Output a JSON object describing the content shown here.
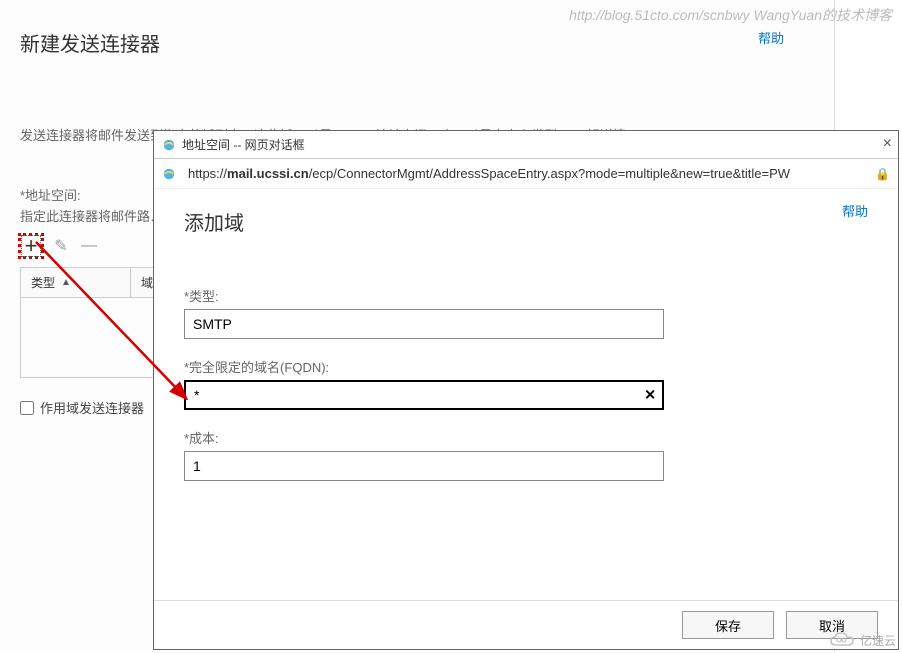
{
  "watermark": "http://blog.51cto.com/scnbwy WangYuan的技术博客",
  "bg": {
    "title": "新建发送连接器",
    "help": "帮助",
    "desc1": "发送连接器将邮件发送到指定的域列表。这些域可以是 SMTP 地址空间，也可以是自定义类型。",
    "learn": "了解详情…",
    "section_label": "*地址空间:",
    "subtext": "指定此连接器将邮件路…",
    "col1": "类型",
    "col2": "域",
    "checkbox": "作用域发送连接器"
  },
  "dialog": {
    "window_title": "地址空间 -- 网页对话框",
    "url_host": "mail.ucssi.cn",
    "url_path": "/ecp/ConnectorMgmt/AddressSpaceEntry.aspx?mode=multiple&new=true&title=PW",
    "help": "帮助",
    "title": "添加域",
    "label_type": "*类型:",
    "value_type": "SMTP",
    "label_fqdn": "*完全限定的域名(FQDN):",
    "value_fqdn": "*",
    "label_cost": "*成本:",
    "value_cost": "1",
    "save": "保存",
    "cancel": "取消"
  },
  "logo": "亿速云"
}
